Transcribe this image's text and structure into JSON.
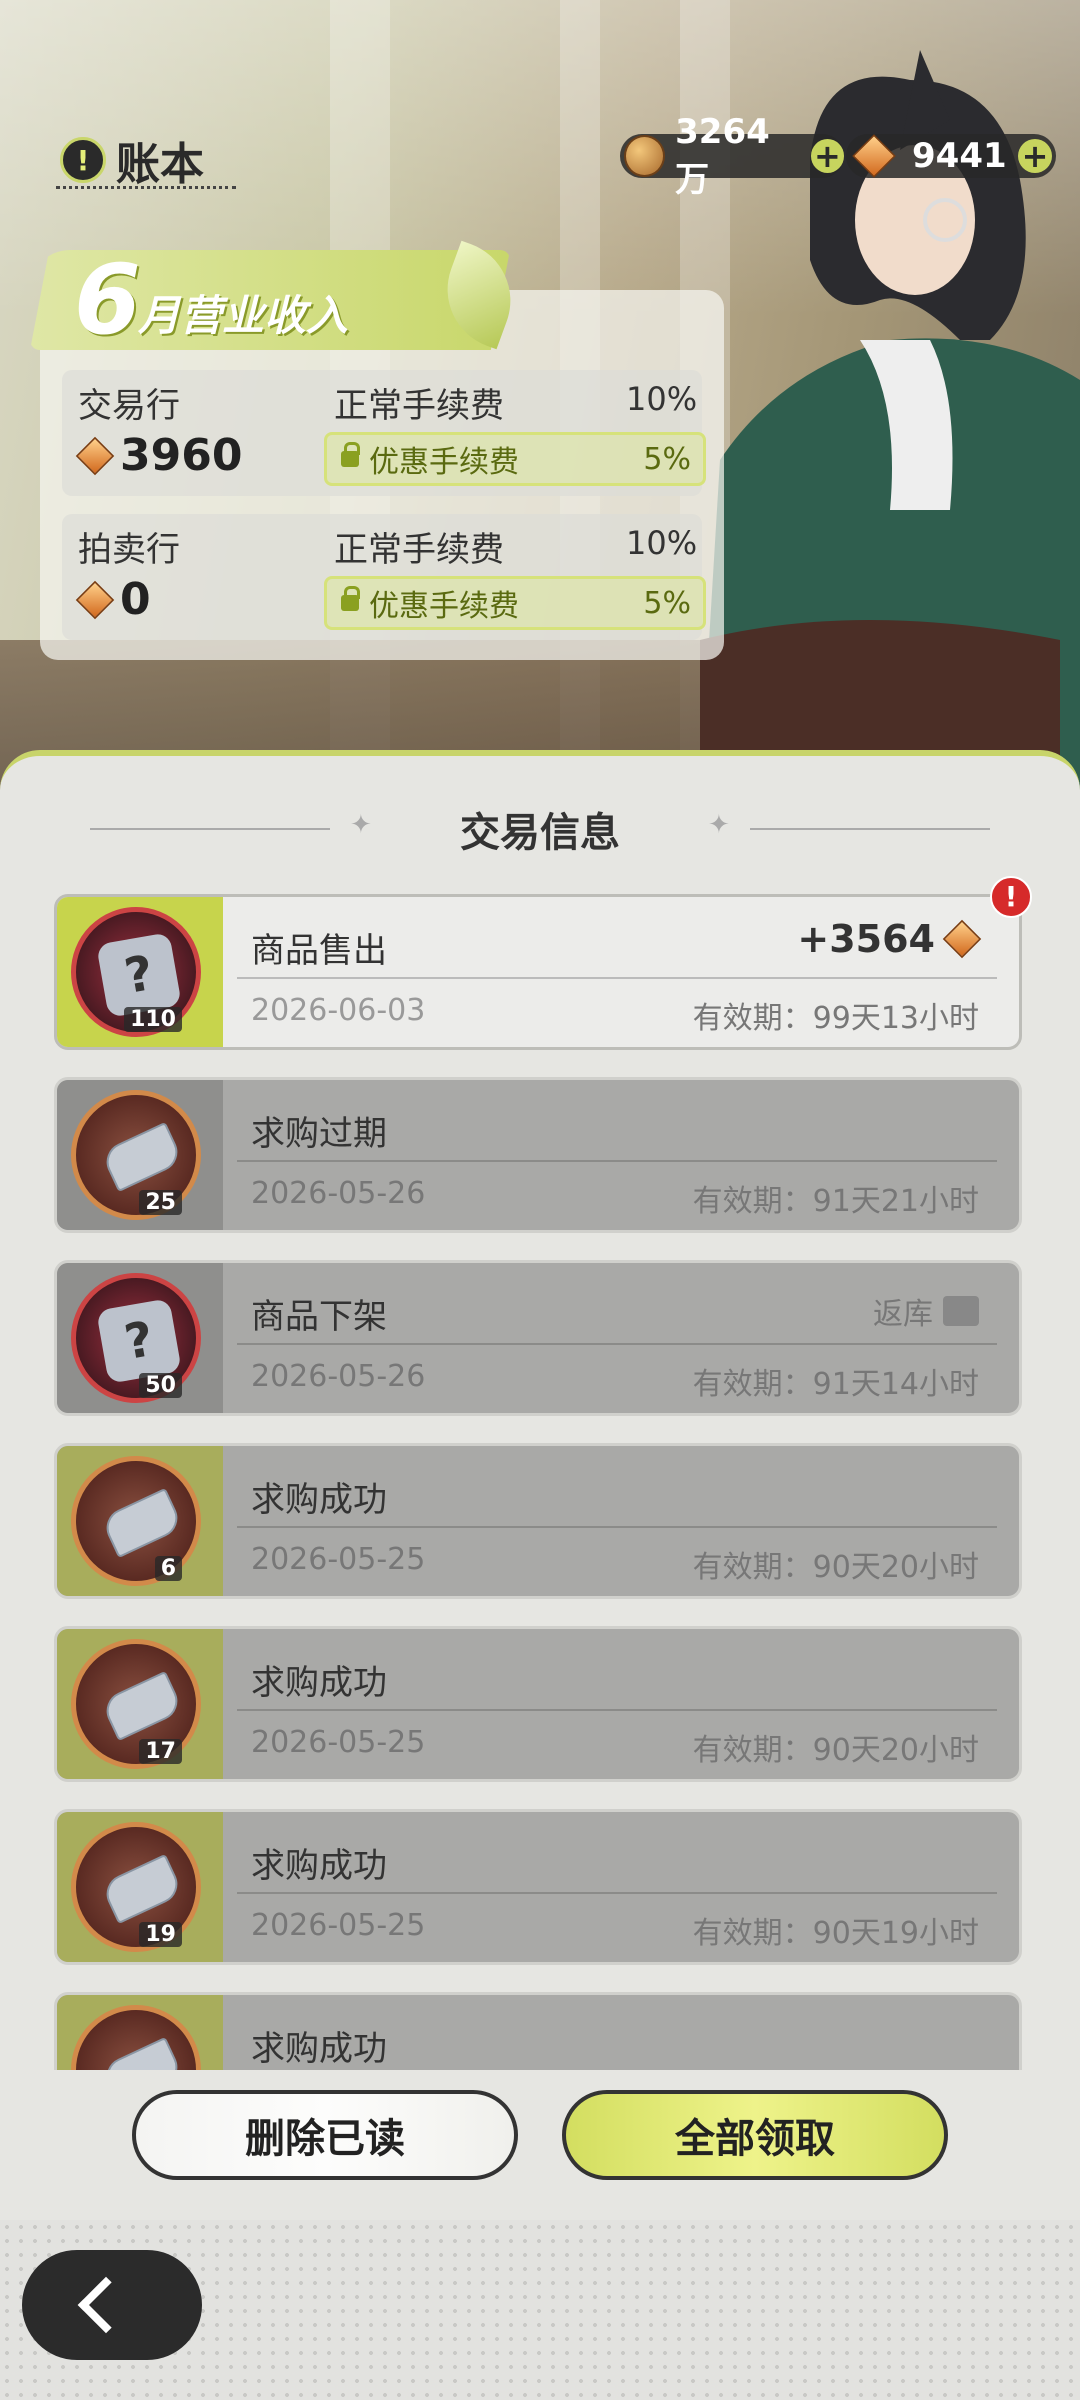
{
  "header": {
    "title": "账本",
    "coins": "3264万",
    "stars": "9441"
  },
  "income": {
    "month_num": "6",
    "month_label": "月营业收入",
    "rows": [
      {
        "name": "交易行",
        "amount": "3960",
        "normal_label": "正常手续费",
        "normal_pct": "10%",
        "disc_label": "优惠手续费",
        "disc_pct": "5%"
      },
      {
        "name": "拍卖行",
        "amount": "0",
        "normal_label": "正常手续费",
        "normal_pct": "10%",
        "disc_label": "优惠手续费",
        "disc_pct": "5%"
      }
    ]
  },
  "section": {
    "title": "交易信息"
  },
  "items": [
    {
      "title": "商品售出",
      "date": "2026-06-03",
      "expiry": "有效期：99天13小时",
      "qty": "110",
      "amount": "+3564",
      "alert": "!"
    },
    {
      "title": "求购过期",
      "date": "2026-05-26",
      "expiry": "有效期：91天21小时",
      "qty": "25"
    },
    {
      "title": "商品下架",
      "date": "2026-05-26",
      "expiry": "有效期：91天14小时",
      "qty": "50",
      "return_label": "返库"
    },
    {
      "title": "求购成功",
      "date": "2026-05-25",
      "expiry": "有效期：90天20小时",
      "qty": "6"
    },
    {
      "title": "求购成功",
      "date": "2026-05-25",
      "expiry": "有效期：90天20小时",
      "qty": "17"
    },
    {
      "title": "求购成功",
      "date": "2026-05-25",
      "expiry": "有效期：90天19小时",
      "qty": "19"
    },
    {
      "title": "求购成功"
    }
  ],
  "buttons": {
    "delete_read": "删除已读",
    "claim_all": "全部领取"
  },
  "colors": {
    "accent": "#c8d46a",
    "alert": "#d62a2a"
  }
}
